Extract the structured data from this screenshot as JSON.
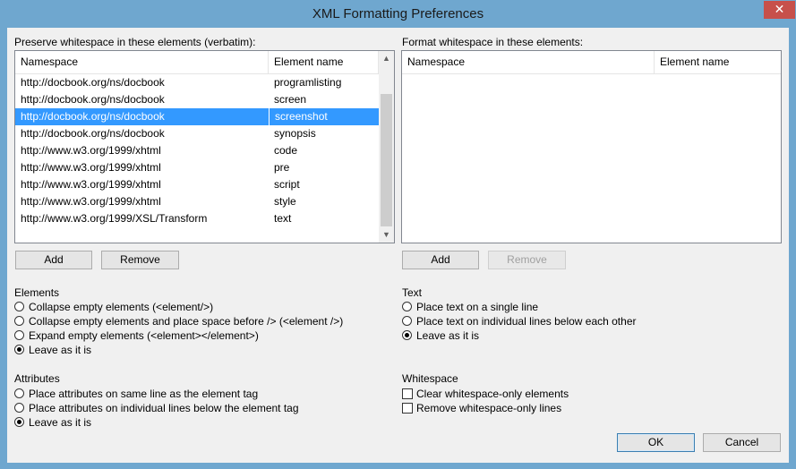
{
  "window": {
    "title": "XML Formatting Preferences",
    "close_glyph": "✕"
  },
  "preserve": {
    "label": "Preserve whitespace in these elements (verbatim):",
    "columns": [
      "Namespace",
      "Element name"
    ],
    "rows": [
      {
        "ns": "http://docbook.org/ns/docbook",
        "el": "programlisting"
      },
      {
        "ns": "http://docbook.org/ns/docbook",
        "el": "screen"
      },
      {
        "ns": "http://docbook.org/ns/docbook",
        "el": "screenshot"
      },
      {
        "ns": "http://docbook.org/ns/docbook",
        "el": "synopsis"
      },
      {
        "ns": "http://www.w3.org/1999/xhtml",
        "el": "code"
      },
      {
        "ns": "http://www.w3.org/1999/xhtml",
        "el": "pre"
      },
      {
        "ns": "http://www.w3.org/1999/xhtml",
        "el": "script"
      },
      {
        "ns": "http://www.w3.org/1999/xhtml",
        "el": "style"
      },
      {
        "ns": "http://www.w3.org/1999/XSL/Transform",
        "el": "text"
      }
    ],
    "selected_index": 2,
    "add_label": "Add",
    "remove_label": "Remove"
  },
  "format": {
    "label": "Format whitespace in these elements:",
    "columns": [
      "Namespace",
      "Element name"
    ],
    "add_label": "Add",
    "remove_label": "Remove"
  },
  "elements": {
    "label": "Elements",
    "options": [
      "Collapse empty elements (<element/>)",
      "Collapse empty elements and place space before /> (<element />)",
      "Expand empty elements (<element></element>)",
      "Leave as it is"
    ],
    "selected": 3
  },
  "attributes": {
    "label": "Attributes",
    "options": [
      "Place attributes on same line as the element tag",
      "Place attributes on individual lines below the element tag",
      "Leave as it is"
    ],
    "selected": 2
  },
  "text": {
    "label": "Text",
    "options": [
      "Place text on a single line",
      "Place text on individual lines below each other",
      "Leave as it is"
    ],
    "selected": 2
  },
  "whitespace": {
    "label": "Whitespace",
    "options": [
      {
        "label": "Clear whitespace-only elements",
        "checked": false
      },
      {
        "label": "Remove whitespace-only lines",
        "checked": false
      }
    ]
  },
  "dialog": {
    "ok_label": "OK",
    "cancel_label": "Cancel"
  }
}
